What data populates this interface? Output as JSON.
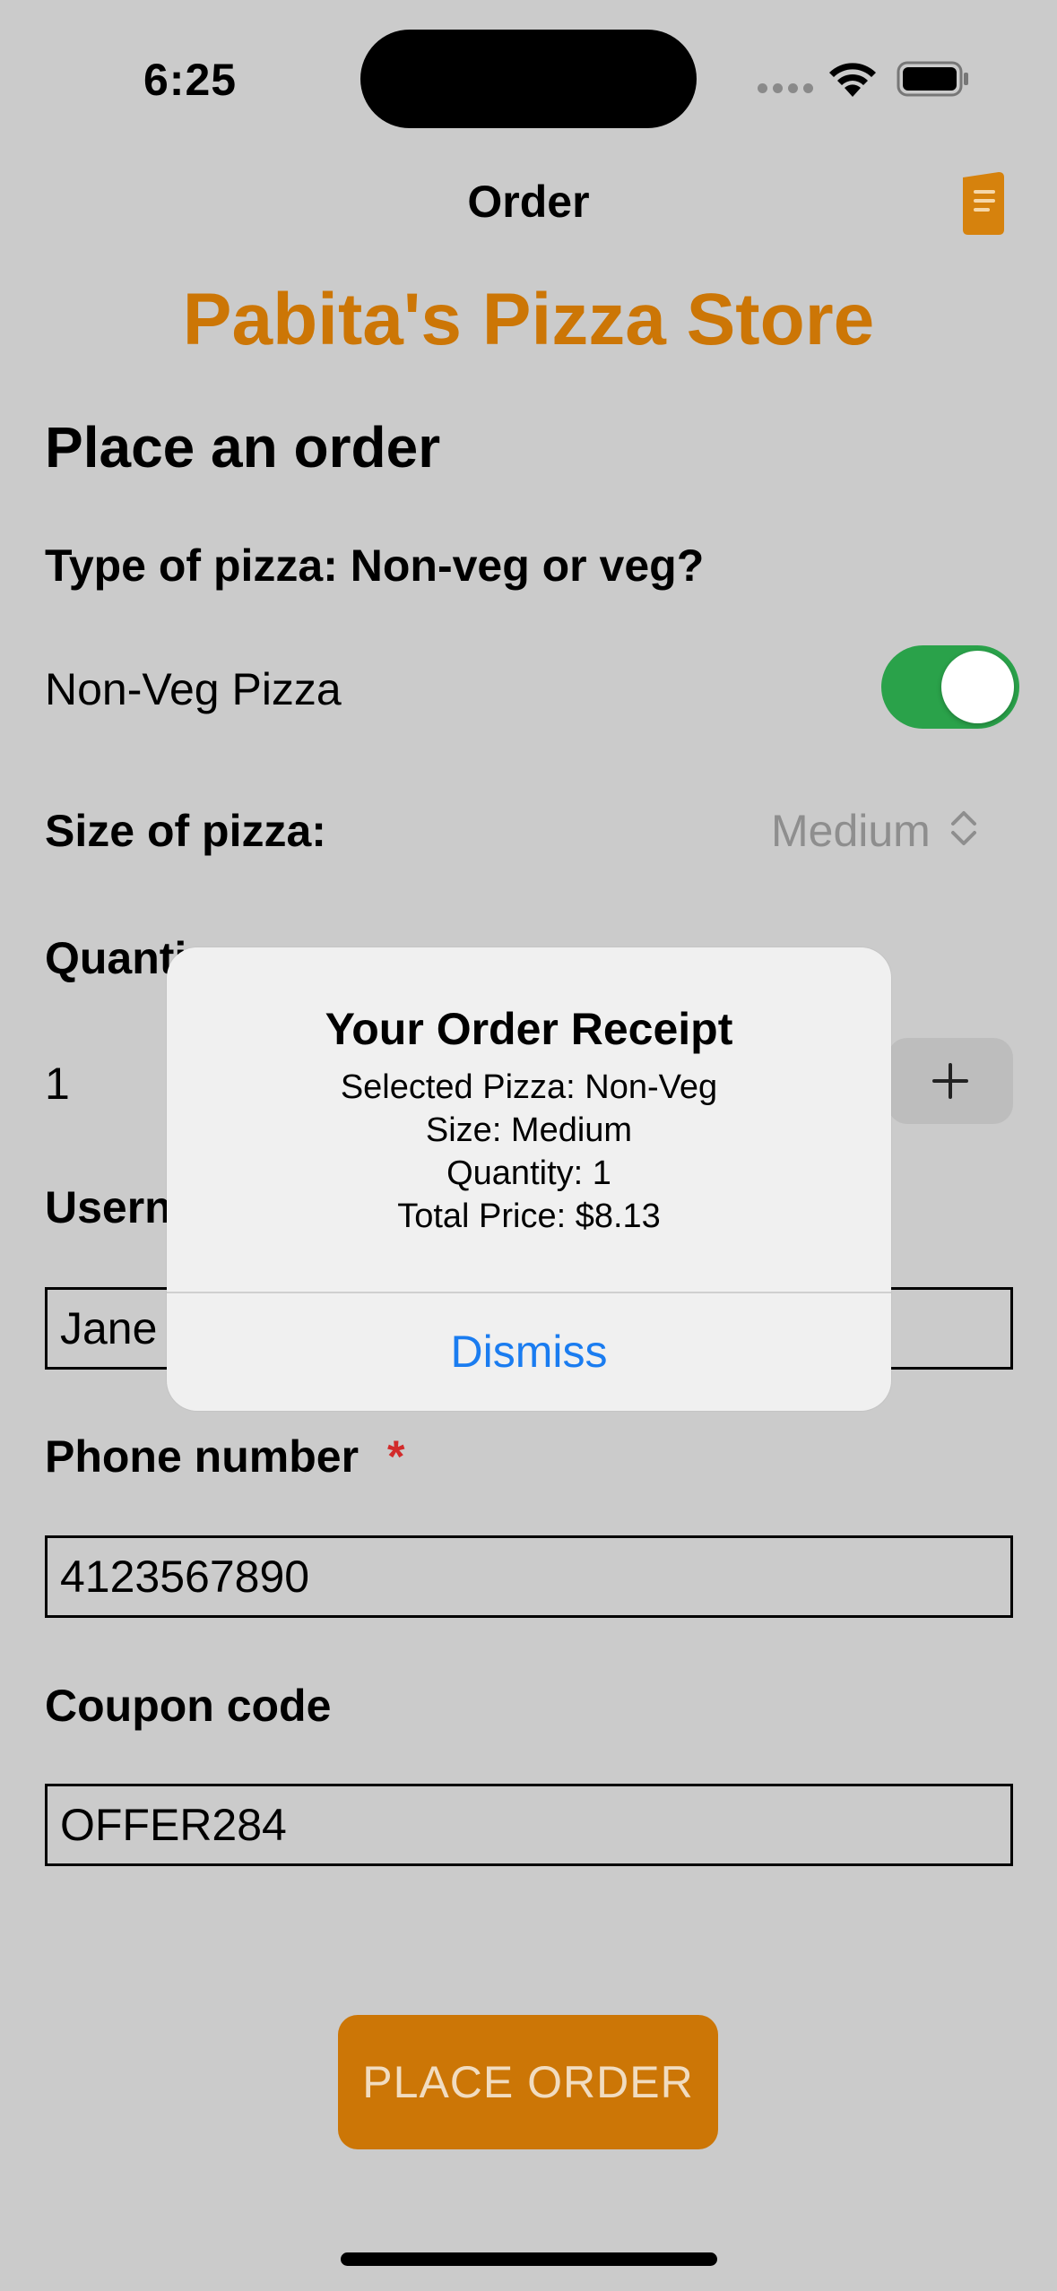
{
  "status_bar": {
    "time": "6:25"
  },
  "nav": {
    "title": "Order",
    "icon": "receipt-icon"
  },
  "store": {
    "title": "Pabita's Pizza Store"
  },
  "form": {
    "section_title": "Place an order",
    "type_label": "Type of pizza: Non-veg or veg?",
    "nonveg_label": "Non-Veg Pizza",
    "nonveg_on": true,
    "size_label": "Size of pizza:",
    "size_value": "Medium",
    "quantity_label": "Quanti",
    "quantity_value": "1",
    "username_label": "Usern",
    "username_value": "Jane",
    "phone_label": "Phone number",
    "phone_required": "*",
    "phone_value": "4123567890",
    "coupon_label": "Coupon code",
    "coupon_value": "OFFER284",
    "place_order": "PLACE ORDER"
  },
  "alert": {
    "title": "Your Order Receipt",
    "lines": [
      "Selected Pizza: Non-Veg",
      "Size: Medium",
      "Quantity: 1",
      "Total Price: $8.13"
    ],
    "dismiss": "Dismiss"
  },
  "colors": {
    "accent": "#cc7606",
    "toggle_on": "#2aa24a",
    "link": "#1a7cf0",
    "required": "#d22b2b"
  }
}
